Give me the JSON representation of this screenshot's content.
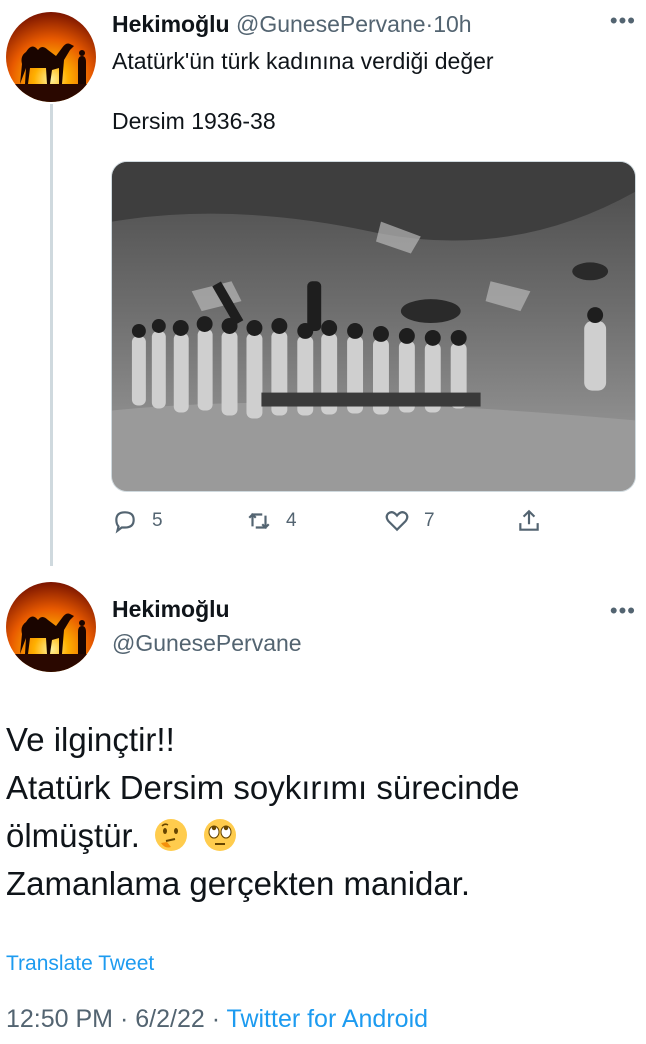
{
  "tweet1": {
    "author_name": "Hekimoğlu",
    "handle": "@GunesePervane",
    "separator": "·",
    "time": "10h",
    "text_line1": "Atatürk'ün türk kadınına verdiği değer",
    "text_line2": "Dersim 1936-38",
    "replies": "5",
    "retweets": "4",
    "likes": "7"
  },
  "tweet2": {
    "author_name": "Hekimoğlu",
    "handle": "@GunesePervane",
    "body_line1": "Ve ilginçtir!!",
    "body_line2": "Atatürk Dersim soykırımı sürecinde",
    "body_line3": "ölmüştür.",
    "body_line4": "Zamanlama gerçekten manidar.",
    "translate": "Translate Tweet",
    "time": "12:50 PM",
    "date": "6/2/22",
    "separator": "·",
    "source": "Twitter for Android"
  },
  "icons": {
    "avatar": "camel-sunset-avatar",
    "more": "more-icon",
    "reply": "reply-icon",
    "retweet": "retweet-icon",
    "like": "heart-icon",
    "share": "share-icon",
    "emoji1": "thinking-face-emoji",
    "emoji2": "face-with-rolling-eyes-emoji"
  },
  "colors": {
    "accent": "#1d9bf0",
    "muted": "#536471",
    "text": "#0f1419",
    "thread_line": "#cfd9de"
  }
}
